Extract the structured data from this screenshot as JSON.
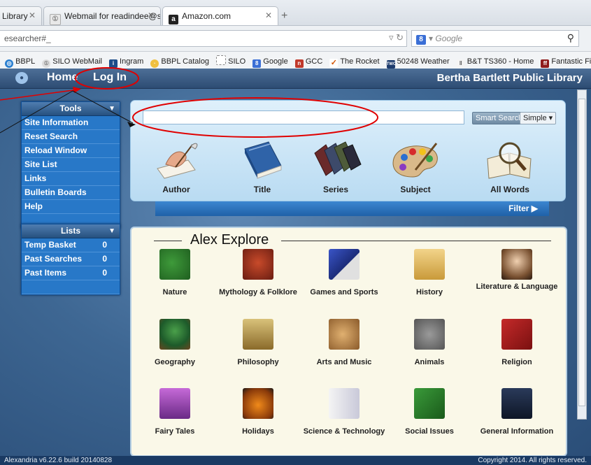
{
  "browser": {
    "tabs": [
      {
        "label": "Library",
        "active": false
      },
      {
        "label": "Webmail for readindee@st...",
        "active": false
      },
      {
        "label": "Amazon.com",
        "active": true
      }
    ],
    "new_tab_icon": "plus-icon",
    "url": "esearcher#_",
    "search_placeholder": "Google",
    "bookmarks": [
      "BBPL",
      "SILO WebMail",
      "Ingram",
      "BBPL Catalog",
      "SILO",
      "Google",
      "GCC",
      "The Rocket",
      "50248 Weather",
      "B&T TS360 - Home",
      "Fantastic Fiction"
    ]
  },
  "nav": {
    "home": "Home",
    "login": "Log In",
    "library_name": "Bertha Bartlett Public Library"
  },
  "tools": {
    "header": "Tools",
    "items": [
      "Site Information",
      "Reset Search",
      "Reload Window",
      "Site List",
      "Links",
      "Bulletin Boards",
      "Help"
    ]
  },
  "lists": {
    "header": "Lists",
    "items": [
      {
        "label": "Temp Basket",
        "count": "0"
      },
      {
        "label": "Past Searches",
        "count": "0"
      },
      {
        "label": "Past Items",
        "count": "0"
      }
    ]
  },
  "search": {
    "value": "",
    "smart_button": "Smart Search",
    "simple_button": "Simple ▾",
    "types": [
      "Author",
      "Title",
      "Series",
      "Subject",
      "All Words"
    ],
    "filter": "Filter ▶"
  },
  "explore": {
    "title": "Alex Explore",
    "categories": [
      "Nature",
      "Mythology & Folklore",
      "Games and Sports",
      "History",
      "Literature & Language",
      "Geography",
      "Philosophy",
      "Arts and Music",
      "Animals",
      "Religion",
      "Fairy Tales",
      "Holidays",
      "Science & Technology",
      "Social Issues",
      "General Information"
    ]
  },
  "status": {
    "version": "Alexandria v6.22.6 build 20140828",
    "copyright": "Copyright 2014. All rights reserved."
  },
  "colors": {
    "nav_bar": "#2d4c73",
    "sidebar": "#2878c8",
    "search_panel": "#cfe7f7",
    "explore_bg": "#faf8e8",
    "annotation": "#e00000"
  }
}
